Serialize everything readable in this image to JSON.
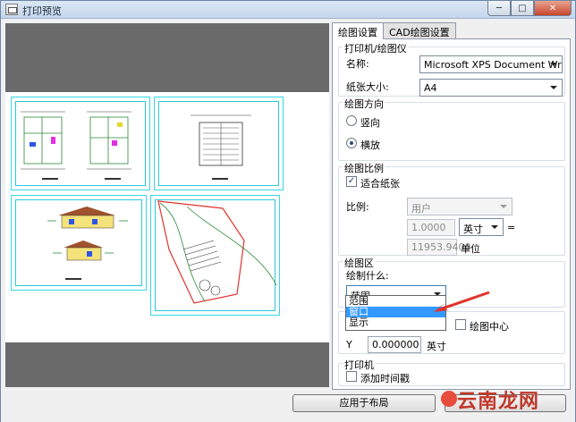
{
  "window": {
    "title": "打印预览"
  },
  "tabs": [
    {
      "label": "绘图设置"
    },
    {
      "label": "CAD绘图设置"
    }
  ],
  "printer": {
    "group_title": "打印机/绘图仪",
    "name_label": "名称:",
    "name_value": "Microsoft XPS Document Writer",
    "paper_label": "纸张大小:",
    "paper_value": "A4"
  },
  "orientation": {
    "group_title": "绘图方向",
    "portrait_label": "竖向",
    "landscape_label": "横放",
    "selected": "landscape"
  },
  "scale": {
    "group_title": "绘图比例",
    "fit_label": "适合纸张",
    "fit_checked": true,
    "ratio_label": "比例:",
    "ratio_value": "用户",
    "value1": "1.0000",
    "unit1": "英寸",
    "equals": "=",
    "value2": "11953.9400",
    "unit2": "单位"
  },
  "area": {
    "group_title": "绘图区",
    "what_label": "绘制什么:",
    "what_value": "范围",
    "options": [
      "范围",
      "窗口",
      "显示"
    ],
    "selected_option_index": 1
  },
  "offset": {
    "center_label": "绘图中心",
    "y_label": "Y",
    "y_value": "0.000000",
    "y_unit": "英寸"
  },
  "print": {
    "group_title": "打印机",
    "timestamp_label": "添加时间戳"
  },
  "buttons": {
    "apply_layout": "应用于布局"
  },
  "watermark": {
    "text": "云南龙网"
  },
  "colors": {
    "accent_red": "#e0342c",
    "cyan_border": "#36d8e6",
    "selection_blue": "#3399ff"
  }
}
